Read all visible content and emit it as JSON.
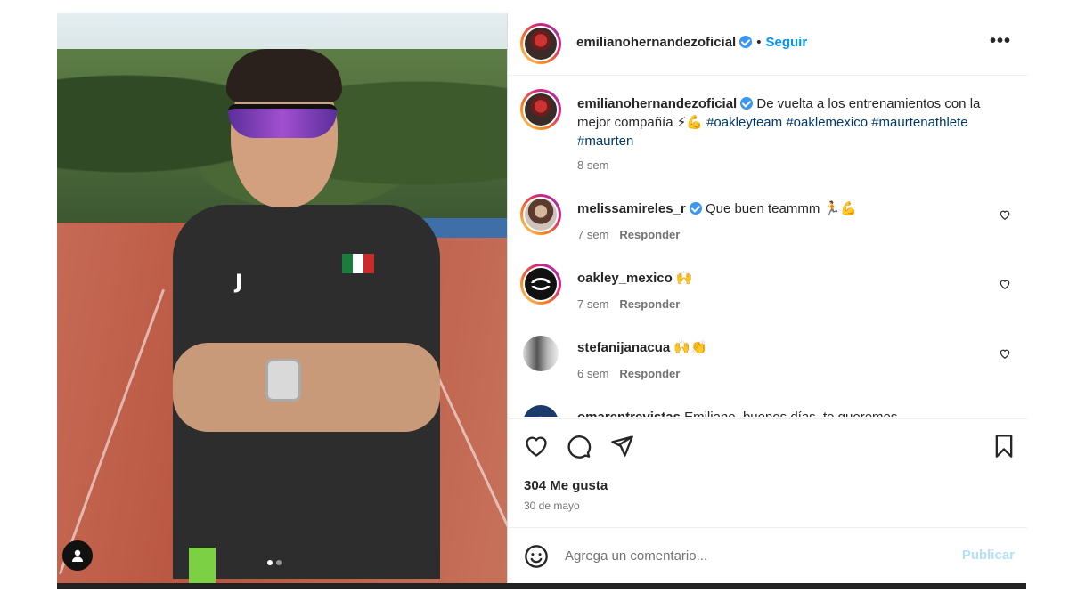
{
  "post": {
    "author": "emilianohernandezoficial",
    "separator": "•",
    "follow_label": "Seguir",
    "more_label": "•••",
    "caption_text": " De vuelta a los entrenamientos con la mejor compañía ⚡💪 ",
    "hashtags": [
      "#oakleyteam",
      "#oaklemexico",
      "#maurtenathlete",
      "#maurten"
    ],
    "caption_time": "8 sem",
    "likes": "304 Me gusta",
    "date": "30 de mayo",
    "carousel_count": 2,
    "carousel_active": 1
  },
  "comments": [
    {
      "user": "melissamireles_r",
      "verified": true,
      "text": "Que buen teammm 🏃💪",
      "time": "7 sem",
      "reply": "Responder"
    },
    {
      "user": "oakley_mexico",
      "verified": false,
      "text": "🙌",
      "time": "7 sem",
      "reply": "Responder"
    },
    {
      "user": "stefanijanacua",
      "verified": false,
      "text": "🙌👏",
      "time": "6 sem",
      "reply": "Responder"
    },
    {
      "user": "omarentrevistas",
      "verified": false,
      "text": "Emiliano, buenos días, te queremos",
      "time": "",
      "reply": ""
    }
  ],
  "compose": {
    "placeholder": "Agrega un comentario...",
    "publish_label": "Publicar"
  },
  "colors": {
    "accent": "#0095f6",
    "publish_disabled": "#b2dffc",
    "hashtag": "#00376b",
    "muted": "#737373"
  },
  "icons": [
    "heart-icon",
    "comment-icon",
    "share-icon",
    "bookmark-icon",
    "emoji-icon",
    "user-tag-icon",
    "verified-icon"
  ]
}
